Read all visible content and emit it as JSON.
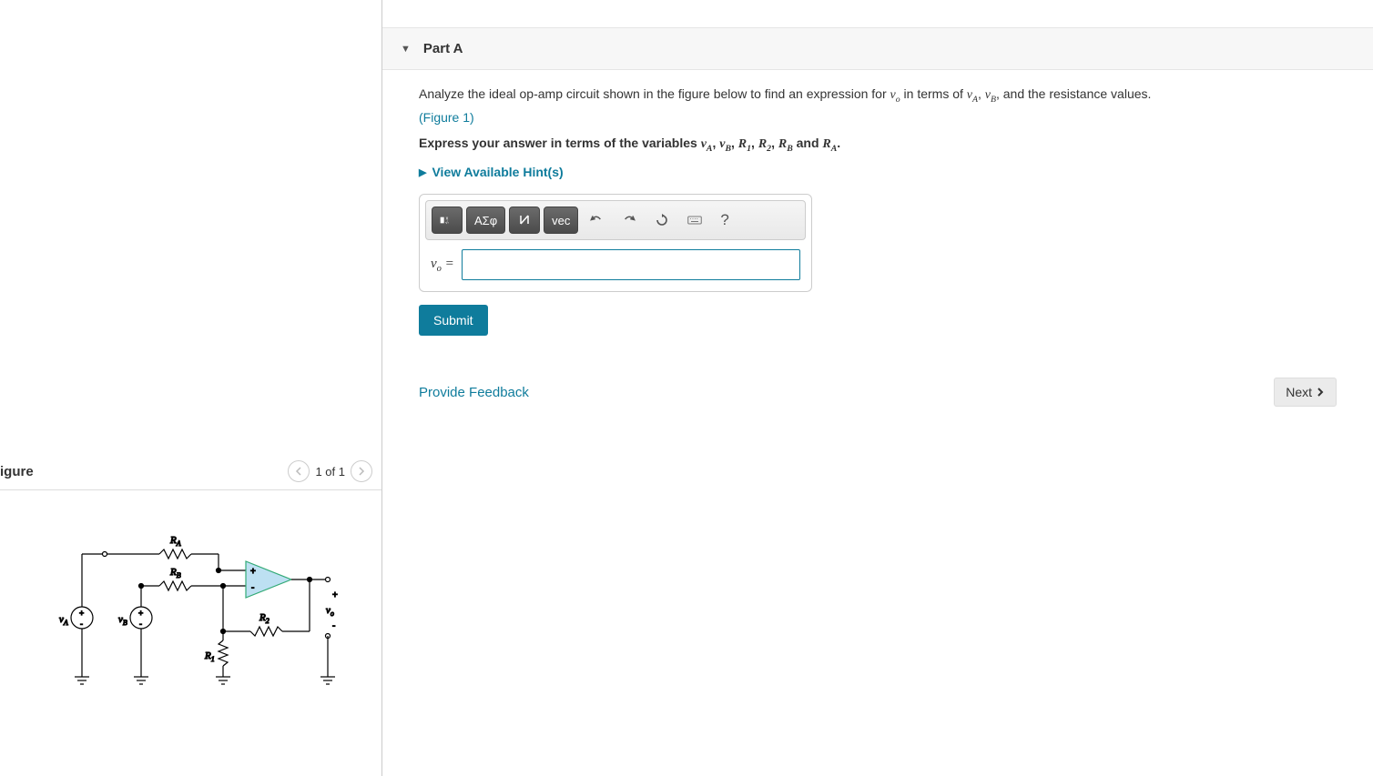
{
  "left": {
    "title": "igure",
    "nav_label": "1 of 1",
    "circuit": {
      "components": [
        "v_A",
        "v_B",
        "R_A",
        "R_B",
        "R_1",
        "R_2",
        "v_o"
      ],
      "op_amp_signs": [
        "+",
        "-"
      ]
    }
  },
  "part": {
    "header": "Part A",
    "prompt_pre": "Analyze the ideal op-amp circuit shown in the figure below to find an expression for ",
    "prompt_var1": "v",
    "prompt_var1_sub": "o",
    "prompt_mid": " in terms of ",
    "prompt_var2": "v",
    "prompt_var2_sub": "A",
    "prompt_sep": ", ",
    "prompt_var3": "v",
    "prompt_var3_sub": "B",
    "prompt_post": ", and the resistance values.",
    "figure_link": "(Figure 1)",
    "bold_pre": "Express your answer in terms of the variables ",
    "bold_vars": "v_A, v_B, R_1, R_2, R_B and R_A",
    "bold_post": ".",
    "hints_label": "View Available Hint(s)",
    "toolbar": {
      "greek": "ΑΣφ",
      "vec": "vec"
    },
    "answer_label_var": "v",
    "answer_label_sub": "o",
    "answer_label_eq": " = ",
    "submit": "Submit"
  },
  "footer": {
    "feedback": "Provide Feedback",
    "next": "Next"
  }
}
